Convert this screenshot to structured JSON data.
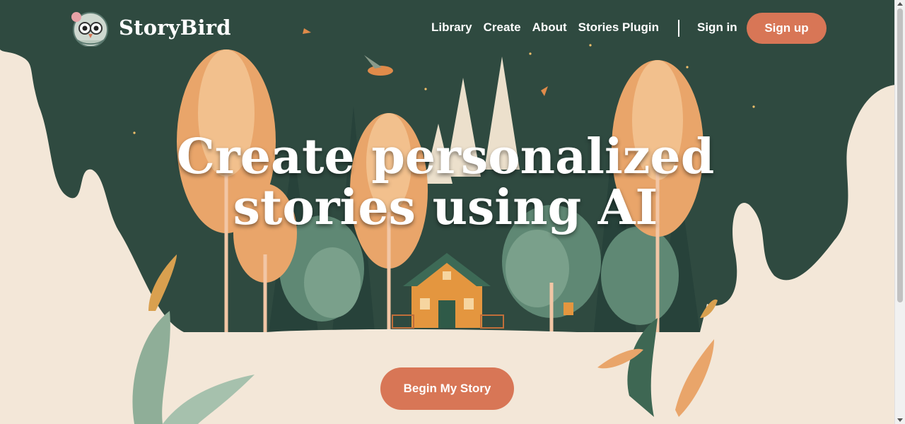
{
  "brand": {
    "name": "StoryBird",
    "logo_icon": "owl-mascot-icon"
  },
  "nav": {
    "links": [
      {
        "label": "Library"
      },
      {
        "label": "Create"
      },
      {
        "label": "About"
      },
      {
        "label": "Stories Plugin"
      }
    ],
    "sign_in": "Sign in",
    "sign_up": "Sign up"
  },
  "hero": {
    "headline_line1": "Create personalized",
    "headline_line2": "stories using AI",
    "cta_label": "Begin My Story"
  },
  "colors": {
    "forest": "#2f4a40",
    "cream": "#f3e7d8",
    "accent": "#d87656",
    "tree_orange": "#e9a56a",
    "tree_light": "#f2c08d"
  }
}
